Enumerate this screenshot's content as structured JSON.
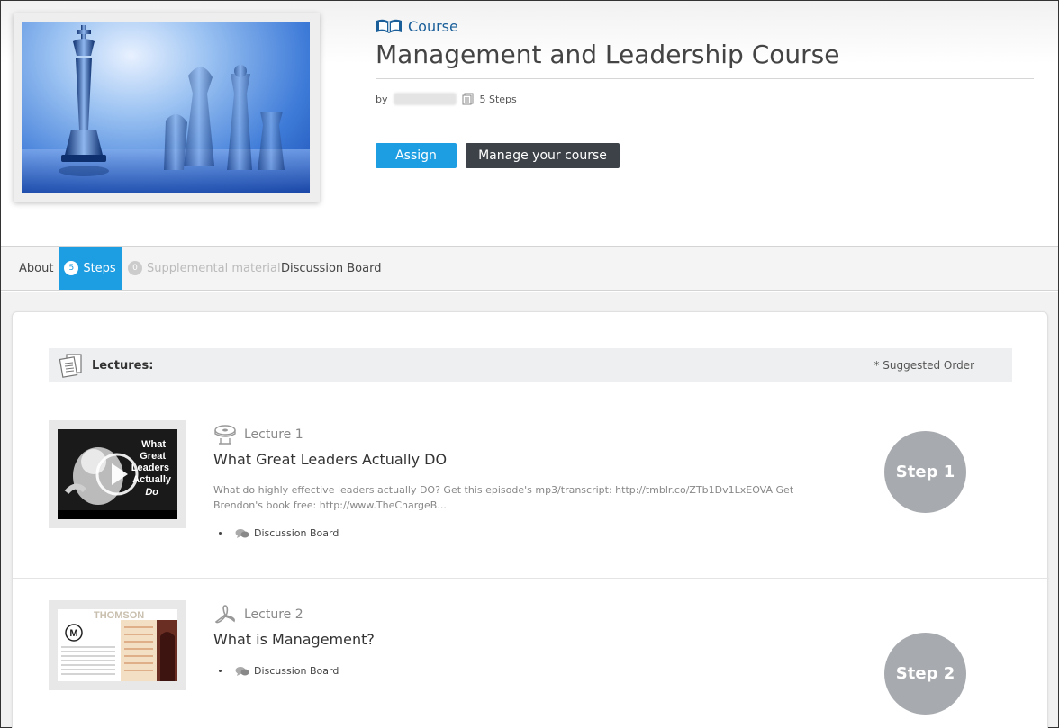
{
  "header": {
    "course_label": "Course",
    "title": "Management and Leadership Course",
    "by_label": "by",
    "steps_count": "5 Steps",
    "assign_label": "Assign",
    "manage_label": "Manage your course"
  },
  "tabs": {
    "about": "About",
    "steps_count": "5",
    "steps": "Steps",
    "supplemental_count": "0",
    "supplemental": "Supplemental material",
    "discussion": "Discussion Board"
  },
  "lectures_section": {
    "label": "Lectures:",
    "suggested_order": "* Suggested Order"
  },
  "lectures": [
    {
      "type": "Lecture 1",
      "title": "What Great Leaders Actually DO",
      "description": "What do highly effective leaders actually DO? Get this episode's mp3/transcript: http://tmblr.co/ZTb1Dv1LxEOVA Get Brendon's book free: http://www.TheChargeB...",
      "link": "Discussion Board",
      "step": "Step 1",
      "thumb_text": [
        "What",
        "Great",
        "Leaders",
        "Actually",
        "Do"
      ]
    },
    {
      "type": "Lecture 2",
      "title": "What is Management?",
      "link": "Discussion Board",
      "step": "Step 2",
      "thumb_text": [
        "THOMSON",
        "M"
      ]
    }
  ],
  "colors": {
    "accent": "#1d9de2",
    "dark_button": "#3c4248",
    "step_circle": "#a7aaae",
    "course_label": "#1a5f9a"
  }
}
